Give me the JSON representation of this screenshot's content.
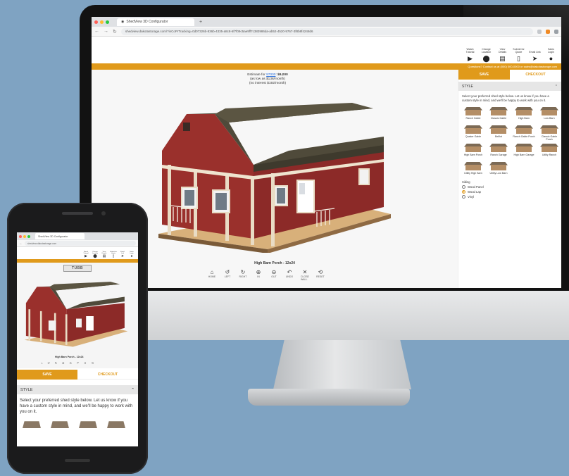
{
  "browser": {
    "tab_title": "ShedView 3D Configurator",
    "url": "shedview.dakotastorage.com/?inCoPrTracking=0d07326b-836b-4335-a8c8-6f7f09c5ae9ff7c383986da-ab52-4520-9767-3f8b8f4248d6"
  },
  "header": {
    "buttons": [
      {
        "label": "Watch Tutorial",
        "icon": "play-icon"
      },
      {
        "label": "Change Location",
        "icon": "location-pin-icon"
      },
      {
        "label": "View Details",
        "icon": "document-icon"
      },
      {
        "label": "Submit for Quote",
        "icon": "clipboard-icon"
      },
      {
        "label": "Email Link",
        "icon": "send-icon"
      },
      {
        "label": "Sales Login",
        "icon": "user-icon"
      }
    ],
    "contact_bar": "Questions? Contact us at (000) 000-0000 or sales@dakotastorage.com"
  },
  "viewer": {
    "estimate_label": "Estimate for",
    "estimate_link": "97000",
    "estimate_price": "$9,000",
    "estimate_monthly": "(as low as $138/month)",
    "estimate_interest": "(no interest $192/month)",
    "model_name": "High Barn Porch - 12x24",
    "controls": [
      {
        "label": "HOME",
        "icon": "home-icon",
        "glyph": "⌂"
      },
      {
        "label": "LEFT",
        "icon": "rotate-left-icon",
        "glyph": "↺"
      },
      {
        "label": "RIGHT",
        "icon": "rotate-right-icon",
        "glyph": "↻"
      },
      {
        "label": "IN",
        "icon": "zoom-in-icon",
        "glyph": "⊕"
      },
      {
        "label": "OUT",
        "icon": "zoom-out-icon",
        "glyph": "⊖"
      },
      {
        "label": "UNDO",
        "icon": "undo-icon",
        "glyph": "↶"
      },
      {
        "label": "CLOSE WALL",
        "icon": "close-wall-icon",
        "glyph": "✕"
      },
      {
        "label": "RESET",
        "icon": "reset-icon",
        "glyph": "⟲"
      }
    ]
  },
  "panel": {
    "save_label": "SAVE",
    "checkout_label": "CHECKOUT",
    "section_title": "STYLE",
    "description": "Select your preferred shed style below. Let us know if you have a custom style in mind, and we'll be happy to work with you on it.",
    "styles": [
      "Ranch Gable",
      "Classic Gable",
      "High Barn",
      "Low Barn",
      "Quaker Gable",
      "Belfiot",
      "Ranch Gable Porch",
      "Classic Gable Porch",
      "High Barn Porch",
      "Ranch Garage",
      "High Barn Garage",
      "Utility Ranch",
      "Utility High Barn",
      "Utility Low Barn"
    ],
    "siding_label": "Siding",
    "siding_options": [
      {
        "label": "Wood Panel",
        "selected": false
      },
      {
        "label": "Wood Lap",
        "selected": true
      },
      {
        "label": "Vinyl",
        "selected": false
      }
    ]
  },
  "phone": {
    "tab_title": "ShedView 3D Configurator",
    "url": "shedview.dakotastorage.com",
    "logo_text": "TUBB",
    "model_name": "High Barn Porch - 12x24",
    "save_label": "SAVE",
    "checkout_label": "CHECKOUT",
    "section_title": "STYLE",
    "description": "Select your preferred shed style below. Let us know if you have a custom style in mind, and we'll be happy to work with you on it."
  },
  "colors": {
    "accent": "#e09a1b",
    "background": "#7fa3c2",
    "shed_red": "#8c2a28",
    "roof": "#4f4a3a"
  }
}
